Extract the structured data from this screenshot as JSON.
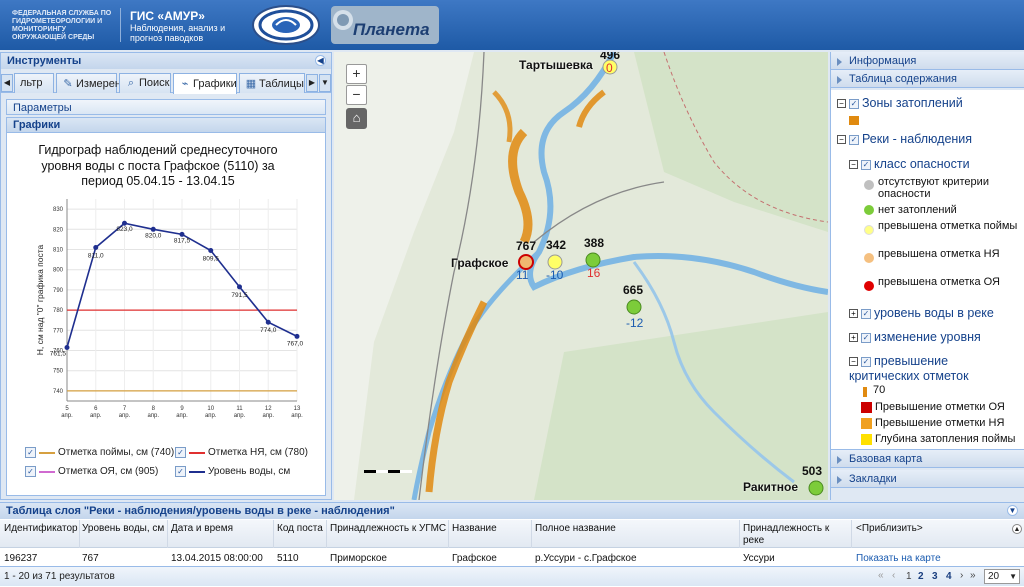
{
  "header": {
    "org": "ФЕДЕРАЛЬНАЯ СЛУЖБА ПО ГИДРОМЕТЕОРОЛОГИИ И МОНИТОРИНГУ ОКРУЖАЮЩЕЙ СРЕДЫ",
    "app_title": "ГИС «АМУР»",
    "app_subtitle": "Наблюдения, анализ и прогноз паводков",
    "logo2_text": "Планета"
  },
  "left_panel": {
    "title": "Инструменты",
    "tabs": [
      {
        "label": "льтр",
        "icon": ""
      },
      {
        "label": "Измерения",
        "icon": "✎"
      },
      {
        "label": "Поиск",
        "icon": "⌕"
      },
      {
        "label": "Графики",
        "icon": "⌁"
      },
      {
        "label": "Таблицы",
        "icon": "▦"
      }
    ],
    "params_label": "Параметры",
    "graphs_label": "Графики"
  },
  "chart_data": {
    "type": "line",
    "title": "Гидрограф наблюдений среднесуточного уровня воды с поста Графское (5110) за период 05.04.15 - 13.04.15",
    "ylabel": "Н, см над \"0\" графика поста",
    "ylim": [
      735,
      835
    ],
    "yticks": [
      740,
      750,
      760,
      770,
      780,
      790,
      800,
      810,
      820,
      830
    ],
    "categories": [
      "5 апр.",
      "6 апр.",
      "7 апр.",
      "8 апр.",
      "9 апр.",
      "10 апр.",
      "11 апр.",
      "12 апр.",
      "13 апр."
    ],
    "series": [
      {
        "name": "Уровень воды, см",
        "values": [
          761.5,
          811.0,
          823.0,
          820.0,
          817.5,
          809.5,
          791.5,
          774.0,
          767.0
        ],
        "color": "#1f2f8f"
      }
    ],
    "value_labels": [
      "761,5",
      "811,0",
      "823,0",
      "820,0",
      "817,5",
      "809,5",
      "791,5",
      "774,0",
      "767,0"
    ],
    "reference_lines": [
      {
        "name": "Отметка поймы, см (740)",
        "value": 740,
        "color": "#d6a040"
      },
      {
        "name": "Отметка НЯ, см (780)",
        "value": 780,
        "color": "#e03030"
      },
      {
        "name": "Отметка ОЯ, см (905)",
        "value": 905,
        "color": "#d06ad0"
      }
    ],
    "grid": true
  },
  "legend": {
    "item1": "Отметка поймы, см (740)",
    "item2": "Отметка НЯ, см (780)",
    "item3": "Отметка ОЯ, см (905)",
    "item4": "Уровень воды, см"
  },
  "map": {
    "zoom_in": "+",
    "zoom_out": "−",
    "home": "⌂",
    "labels": {
      "tartyshevka": "Тартышевка",
      "grafskoe": "Графское",
      "rakitnoe": "Ракитное"
    },
    "stations": [
      {
        "value": "496",
        "delta": "0",
        "color": "#ffff66",
        "delta_color": "#e03030"
      },
      {
        "value": "767",
        "delta": "11",
        "color": "#f0b870",
        "delta_color": "#1a5bb0"
      },
      {
        "value": "342",
        "delta": "-10",
        "color": "#ffff66",
        "delta_color": "#1a5bb0"
      },
      {
        "value": "388",
        "delta": "16",
        "color": "#7ccc3a",
        "delta_color": "#e03030"
      },
      {
        "value": "665",
        "delta": "-12",
        "color": "#7ccc3a",
        "delta_color": "#1a5bb0"
      },
      {
        "value": "503",
        "delta": "",
        "color": "#7ccc3a",
        "delta_color": "#1a5bb0"
      }
    ]
  },
  "right_panel": {
    "info": "Информация",
    "toc": "Таблица содержания",
    "base_map": "Базовая карта",
    "bookmarks": "Закладки",
    "layers": {
      "flood_zones": "Зоны затоплений",
      "rivers": "Реки - наблюдения",
      "danger_class": "класс опасности",
      "no_criteria": "отсутствуют критерии опасности",
      "no_flood": "нет затоплений",
      "over_floodplain": "превышена отметка поймы",
      "over_nya": "превышена отметка НЯ",
      "over_oya": "превышена отметка ОЯ",
      "water_level": "уровень воды в реке",
      "level_change": "изменение уровня",
      "critical": "превышение критических отметок",
      "critical_value": "70",
      "exceed_oya": "Превышение отметки ОЯ",
      "exceed_nya": "Превышение отметки НЯ",
      "flood_depth": "Глубина затопления поймы"
    },
    "colors": {
      "flood": "#e08a10",
      "grey": "#c0c0c0",
      "green": "#7ccc3a",
      "yellow": "#ffff88",
      "orange": "#f5c080",
      "red": "#e00000",
      "exceed_oya": "#cc0000",
      "exceed_nya": "#f0a020",
      "flood_depth": "#ffe000"
    }
  },
  "table": {
    "title": "Таблица слоя \"Реки - наблюдения/уровень воды в реке - наблюдения\"",
    "columns": [
      "Идентификатор",
      "Уровень воды, см",
      "Дата и время",
      "Код поста",
      "Принадлежность к УГМС",
      "Название",
      "Полное название",
      "Принадлежность к реке",
      "<Приблизить>"
    ],
    "row": [
      "196237",
      "767",
      "13.04.2015 08:00:00",
      "5110",
      "Приморское",
      "Графское",
      "р.Уссури - с.Графское",
      "Уссури",
      "Показать на карте"
    ],
    "results": "1 - 20 из 71 результатов",
    "pages": [
      "2",
      "3",
      "4"
    ],
    "current_page": "1",
    "page_size": "20"
  }
}
